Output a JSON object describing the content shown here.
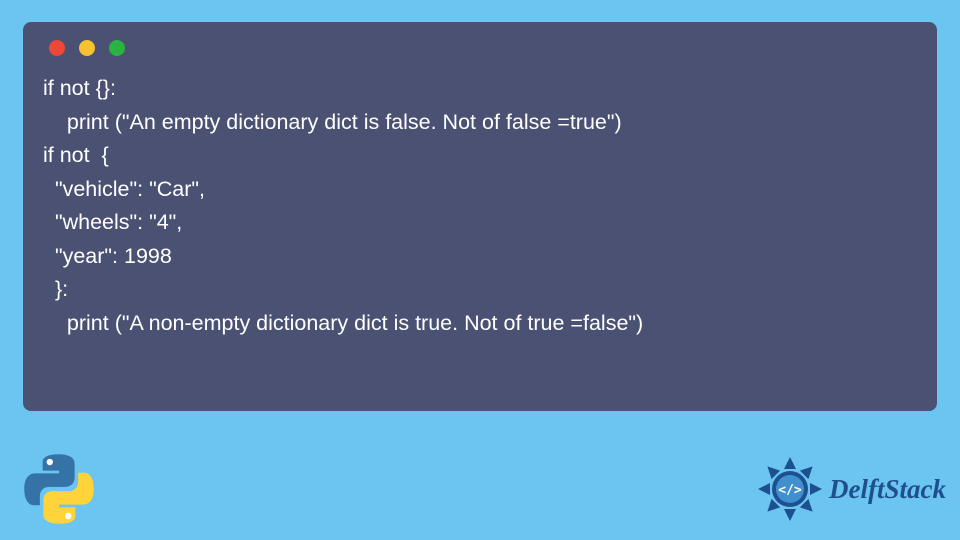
{
  "code": {
    "lines": [
      "if not {}:",
      "    print (\"An empty dictionary dict is false. Not of false =true\")",
      "if not  {",
      "  \"vehicle\": \"Car\",",
      "  \"wheels\": \"4\",",
      "  \"year\": 1998",
      "  }:",
      "    print (\"A non-empty dictionary dict is true. Not of true =false\")"
    ]
  },
  "branding": {
    "site_name": "DelftStack"
  },
  "colors": {
    "background": "#6bc5f0",
    "window_bg": "#4a5173",
    "text": "#ffffff",
    "brand": "#1e4f8f"
  }
}
